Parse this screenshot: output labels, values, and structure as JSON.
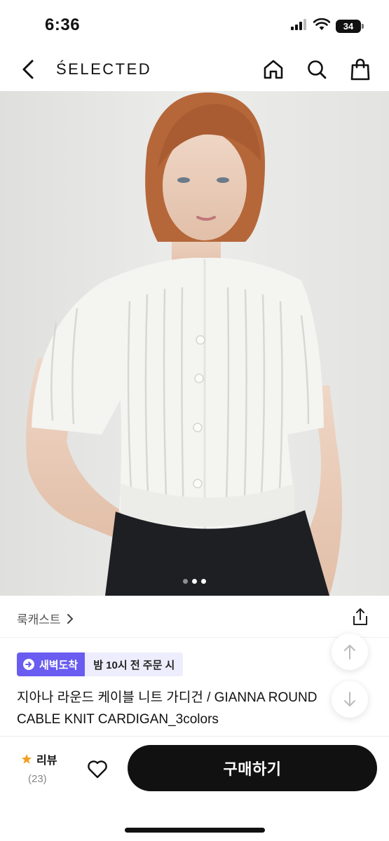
{
  "status_bar": {
    "time": "6:36",
    "battery": "34"
  },
  "nav": {
    "brand": "ŚELECTED"
  },
  "gallery": {
    "slide_count": 3,
    "active_index": 0
  },
  "breadcrumb": {
    "label": "룩캐스트"
  },
  "delivery": {
    "badge": "새벽도착",
    "cutoff": "밤 10시 전 주문 시",
    "accent": "#6a5cf0"
  },
  "product": {
    "title_line1": "지아나 라운드 케이블 니트 가디건 / GIANNA ROUND",
    "title_line2": "CABLE KNIT CARDIGAN_3colors"
  },
  "bottom_bar": {
    "review_label": "리뷰",
    "review_count": "(23)",
    "buy_label": "구매하기",
    "star_color": "#f0a020"
  }
}
